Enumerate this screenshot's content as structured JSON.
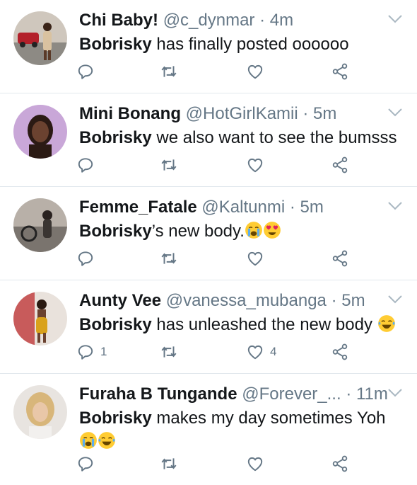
{
  "tweets": [
    {
      "name": "Chi Baby!",
      "handle": "@c_dynmar",
      "separator": "·",
      "time": "4m",
      "mention": "Bobrisky",
      "text": " has finally posted oooooo",
      "reply_count": "",
      "like_count": ""
    },
    {
      "name": "Mini Bonang",
      "handle": "@HotGirlKamii",
      "separator": "·",
      "time": "5m",
      "mention": "Bobrisky",
      "text": " we also want to see the bumsss",
      "reply_count": "",
      "like_count": ""
    },
    {
      "name": "Femme_Fatale",
      "handle": "@Kaltunmi",
      "separator": "·",
      "time": "5m",
      "mention": "Bobrisky",
      "text": "’s new body.",
      "emojis": [
        "crying-emoji",
        "heart-eyes-emoji"
      ],
      "reply_count": "",
      "like_count": ""
    },
    {
      "name": "Aunty Vee",
      "handle": "@vanessa_mubanga",
      "separator": "·",
      "time": "5m",
      "mention": "Bobrisky",
      "text": " has unleashed the new body ",
      "emojis": [
        "tears-of-joy-emoji"
      ],
      "reply_count": "1",
      "like_count": "4"
    },
    {
      "name": "Furaha B Tungande",
      "handle": "@Forever_...",
      "separator": "·",
      "time": "11m",
      "mention": "Bobrisky",
      "text": " makes my day sometimes Yoh",
      "emojis": [
        "crying-emoji",
        "tears-of-joy-emoji"
      ],
      "reply_count": "",
      "like_count": ""
    }
  ],
  "colors": {
    "text": "#14171a",
    "secondary": "#657786",
    "divider": "#e1e8ed"
  },
  "icons": [
    "reply-icon",
    "retweet-icon",
    "like-icon",
    "share-icon",
    "chevron-down-icon"
  ]
}
